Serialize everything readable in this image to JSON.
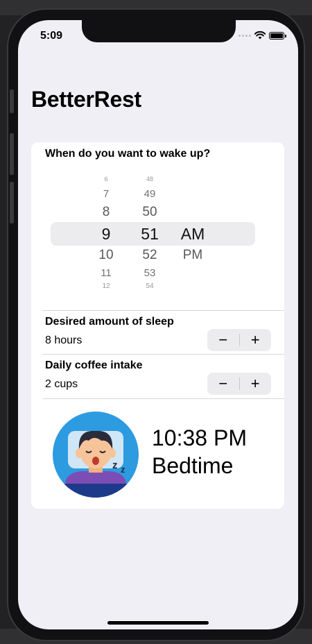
{
  "status_bar": {
    "time": "5:09"
  },
  "app": {
    "title": "BetterRest"
  },
  "wake_section": {
    "label": "When do you want to wake up?",
    "picker": {
      "hours": [
        "6",
        "7",
        "8",
        "9",
        "10",
        "11",
        "12"
      ],
      "minutes": [
        "48",
        "49",
        "50",
        "51",
        "52",
        "53",
        "54"
      ],
      "periods": [
        "AM",
        "PM"
      ],
      "selected_hour": "9",
      "selected_minute": "51",
      "selected_period": "AM"
    }
  },
  "sleep_section": {
    "label": "Desired amount of sleep",
    "value": "8 hours",
    "decrement_label": "−",
    "increment_label": "+"
  },
  "coffee_section": {
    "label": "Daily coffee intake",
    "value": "2 cups",
    "decrement_label": "−",
    "increment_label": "+"
  },
  "result": {
    "time": "10:38 PM",
    "label": "Bedtime"
  },
  "colors": {
    "background": "#f0eff5",
    "card": "#ffffff",
    "icon_circle": "#2d9be0",
    "icon_shirt": "#7b4db5",
    "icon_hair": "#2b2b3a",
    "icon_skin": "#f7c49a"
  }
}
